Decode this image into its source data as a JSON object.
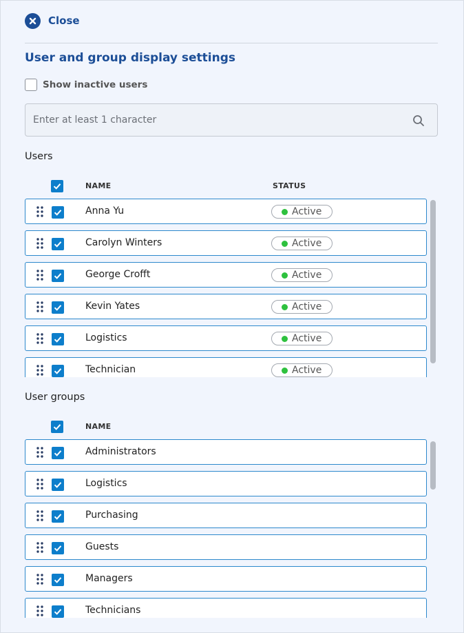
{
  "panel": {
    "close_label": "Close",
    "heading": "User and group display settings",
    "show_inactive_label": "Show inactive users",
    "search_placeholder": "Enter at least 1 character"
  },
  "users": {
    "title": "Users",
    "col_name": "NAME",
    "col_status": "STATUS",
    "rows": [
      {
        "name": "Anna Yu",
        "status": "Active"
      },
      {
        "name": "Carolyn Winters",
        "status": "Active"
      },
      {
        "name": "George Crofft",
        "status": "Active"
      },
      {
        "name": "Kevin Yates",
        "status": "Active"
      },
      {
        "name": "Logistics",
        "status": "Active"
      },
      {
        "name": "Technician",
        "status": "Active"
      }
    ]
  },
  "groups": {
    "title": "User groups",
    "col_name": "NAME",
    "rows": [
      {
        "name": "Administrators"
      },
      {
        "name": "Logistics"
      },
      {
        "name": "Purchasing"
      },
      {
        "name": "Guests"
      },
      {
        "name": "Managers"
      },
      {
        "name": "Technicians"
      }
    ]
  },
  "colors": {
    "accent": "#1c4e97",
    "checkbox": "#0d7ecb",
    "row_border": "#2c88cc",
    "active_dot": "#2ec13e"
  },
  "icons": [
    "close-icon",
    "search-icon",
    "drag-handle-icon",
    "checkbox-checked-icon"
  ]
}
